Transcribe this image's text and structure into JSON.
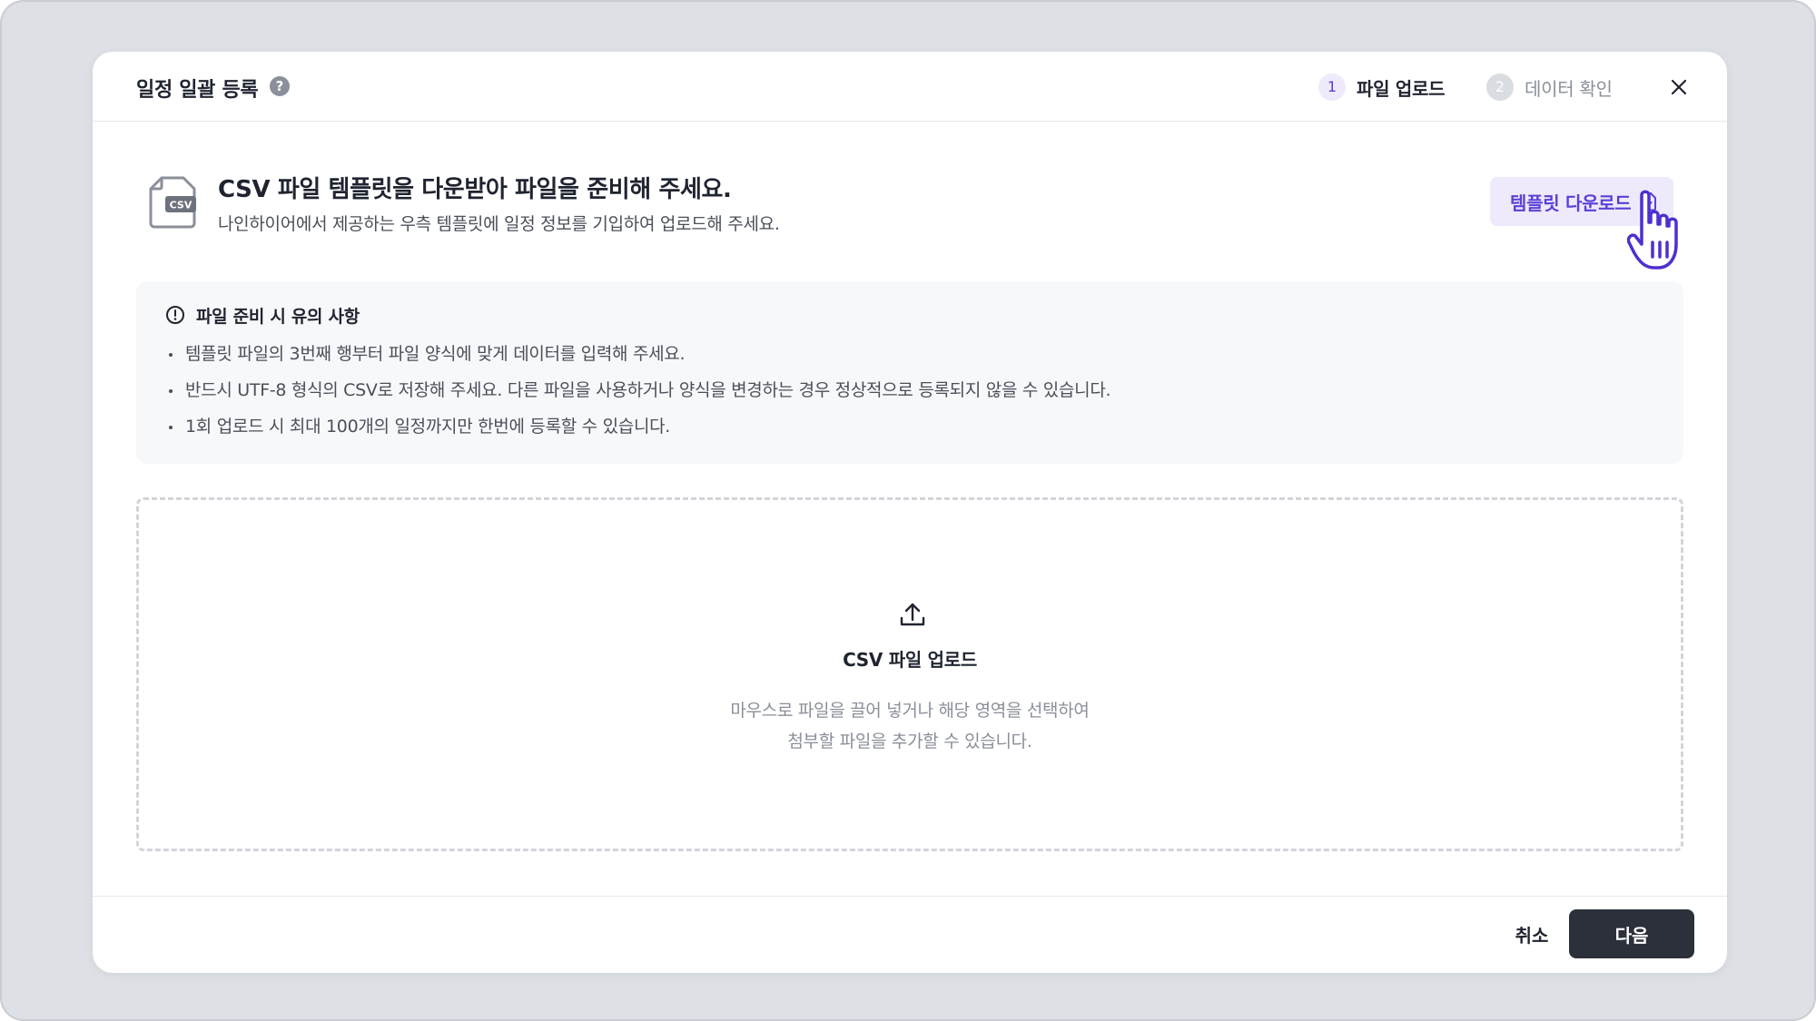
{
  "modal": {
    "title": "일정 일괄 등록",
    "help_icon": "question-circle-icon",
    "steps": [
      {
        "number": "1",
        "label": "파일 업로드",
        "state": "active"
      },
      {
        "number": "2",
        "label": "데이터 확인",
        "state": "inactive"
      }
    ],
    "close_icon": "close-icon"
  },
  "intro": {
    "file_icon_label": "CSV",
    "heading": "CSV 파일 템플릿을 다운받아 파일을 준비해 주세요.",
    "subtext": "나인하이어에서 제공하는 우측 템플릿에 일정 정보를 기입하여 업로드해 주세요.",
    "template_button": {
      "label": "템플릿 다운로드",
      "icon": "file-download-icon"
    }
  },
  "notice": {
    "icon": "alert-circle-icon",
    "title": "파일 준비 시 유의 사항",
    "items": [
      "템플릿 파일의 3번째 행부터 파일 양식에 맞게 데이터를 입력해 주세요.",
      "반드시 UTF-8 형식의 CSV로 저장해 주세요. 다른 파일을 사용하거나 양식을 변경하는 경우 정상적으로 등록되지 않을 수 있습니다.",
      "1회 업로드 시 최대 100개의 일정까지만 한번에 등록할 수 있습니다."
    ]
  },
  "dropzone": {
    "icon": "upload-icon",
    "title": "CSV 파일 업로드",
    "desc_line1": "마우스로 파일을 끌어 넣거나 해당 영역을 선택하여",
    "desc_line2": "첨부할 파일을 추가할 수 있습니다."
  },
  "footer": {
    "cancel_label": "취소",
    "next_label": "다음"
  },
  "colors": {
    "accent": "#5b3fd6",
    "accent_bg": "#eeeafc",
    "primary_button": "#2b303a",
    "backdrop": "#dde0e5"
  }
}
